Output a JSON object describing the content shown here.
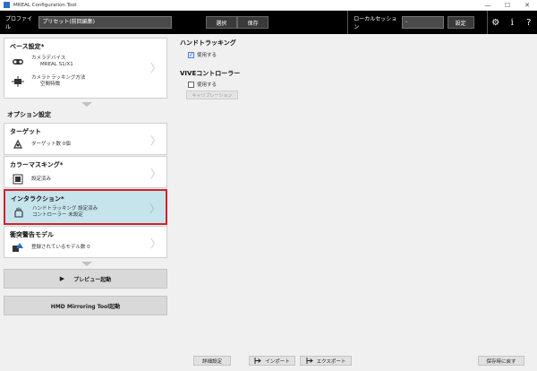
{
  "window": {
    "title": "MREAL Configuration Tool",
    "minimize": "—",
    "maximize": "☐",
    "close": "✕"
  },
  "toolbar": {
    "profile_label": "プロファイル",
    "preset_value": "プリセット(前回編集)",
    "select_label": "選択",
    "save_label": "保存",
    "local_session_label": "ローカルセッション",
    "session_value": "-",
    "set_label": "設定",
    "settings_icon": "⚙",
    "info_icon": "i",
    "help_icon": "?"
  },
  "sidebar": {
    "base": {
      "title": "ベース設定*",
      "camera_label": "カメラデバイス",
      "camera_value": "MREAL S1/X1",
      "tracking_label": "カメラトラッキング方法",
      "tracking_value": "空間特徴"
    },
    "options_title": "オプション設定",
    "target": {
      "title": "ターゲット",
      "text": "ターゲット数 0個"
    },
    "color_masking": {
      "title": "カラーマスキング*",
      "text": "設定済み"
    },
    "interaction": {
      "title": "インタラクション*",
      "line1": "ハンドトラッキング  設定済み",
      "line2": "コントローラー  未設定"
    },
    "collision": {
      "title": "衝突警告モデル",
      "text": "登録されているモデル数 0"
    },
    "preview_label": "プレビュー起動",
    "preview_icon": "▶",
    "hmd_label": "HMD Mirroring Tool起動",
    "chevron": "〉"
  },
  "main": {
    "hand_title": "ハンドトラッキング",
    "hand_use_label": "使用する",
    "hand_checked": true,
    "vive_title": "VIVEコントローラー",
    "vive_use_label": "使用する",
    "vive_checked": false,
    "calibration_label": "キャリブレーション"
  },
  "bottom": {
    "detail_label": "詳細設定",
    "import_label": "インポート",
    "export_label": "エクスポート",
    "revert_label": "保存時に戻す"
  },
  "colors": {
    "highlight_bg": "#c6e4ec",
    "highlight_border": "#d3202a",
    "toolbar_bg": "#000000"
  }
}
